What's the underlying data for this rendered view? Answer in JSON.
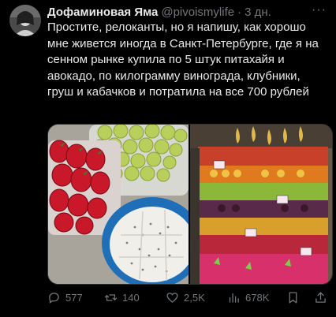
{
  "tweet": {
    "author_name": "Дофаминовая Яма",
    "handle": "@pivoismylife",
    "separator": "·",
    "time": "3 дн.",
    "more_glyph": "···",
    "text": "Простите, релоканты, но я напишу, как хорошо мне живется иногда в Санкт-Петербурге, где я на сенном рынке купила по 5 штук питахайя и авокадо, по килограмму винограда, клубники, груш и кабачков и потратила на все 700 рублей"
  },
  "actions": {
    "replies": "577",
    "retweets": "140",
    "likes": "2,5K",
    "views": "678K"
  },
  "icons": {
    "reply": "reply-icon",
    "retweet": "retweet-icon",
    "like": "heart-icon",
    "views": "views-chart-icon",
    "bookmark": "bookmark-icon",
    "share": "share-icon"
  },
  "colors": {
    "background": "#000000",
    "text": "#e7e9ea",
    "muted": "#71767b",
    "border": "#2f3336"
  }
}
